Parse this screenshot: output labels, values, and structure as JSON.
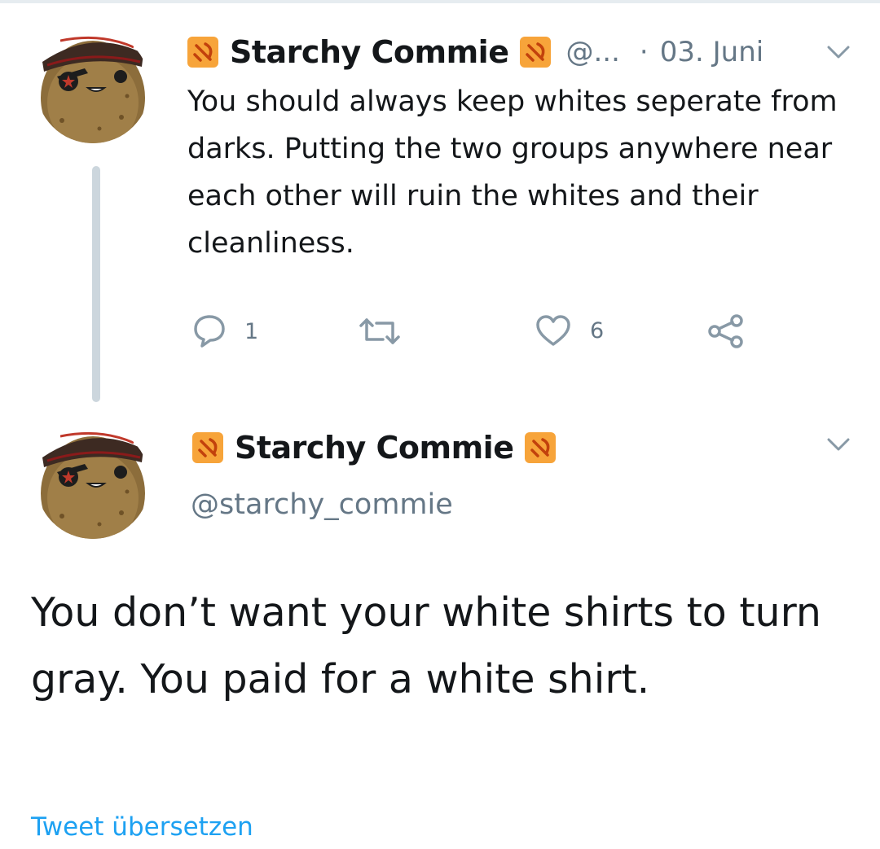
{
  "tweet1": {
    "display_name": "Starchy Commie",
    "handle": "@...",
    "separator": "·",
    "date": "03. Juni",
    "text": "You should always keep whites seperate from darks. Putting the two groups anywhere near each other will ruin the whites and their cleanliness.",
    "reply_count": "1",
    "retweet_count": "",
    "like_count": "6"
  },
  "tweet2": {
    "display_name": "Starchy Commie",
    "handle": "@starchy_commie",
    "text": "You don’t want your white shirts to turn gray. You paid for a white shirt.",
    "translate_label": "Tweet übersetzen"
  },
  "icons": {
    "flag": "hammer-sickle-emoji-icon",
    "menu": "chevron-down-icon",
    "reply": "reply-bubble-icon",
    "retweet": "retweet-icon",
    "like": "heart-icon",
    "share": "share-icon"
  },
  "colors": {
    "text": "#14171a",
    "secondary": "#657786",
    "link": "#1da1f2",
    "flag": "#f7a43a",
    "thread_line": "#ccd6dd"
  }
}
